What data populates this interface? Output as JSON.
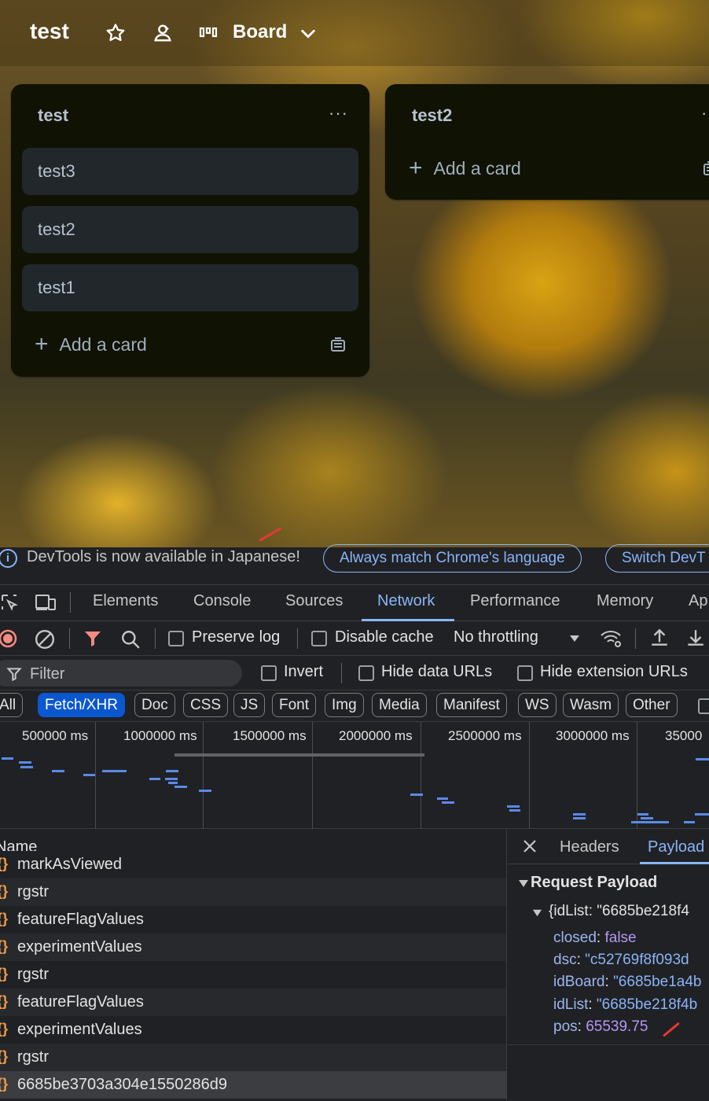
{
  "board_header": {
    "title": "test",
    "view_label": "Board",
    "icons": [
      "star-icon",
      "members-icon",
      "board-view-icon",
      "chevron-down-icon"
    ]
  },
  "lists": [
    {
      "title": "test",
      "menu": "···",
      "cards": [
        "test3",
        "test2",
        "test1"
      ],
      "add_card_label": "Add a card"
    },
    {
      "title": "test2",
      "menu": "··",
      "cards": [],
      "add_card_label": "Add a card"
    }
  ],
  "devtools": {
    "infobar": {
      "message": "DevTools is now available in Japanese!",
      "match_button": "Always match Chrome's language",
      "switch_button": "Switch DevT"
    },
    "tabs": [
      "Elements",
      "Console",
      "Sources",
      "Network",
      "Performance",
      "Memory",
      "Ap"
    ],
    "active_tab": "Network",
    "toolbar": {
      "preserve_log": "Preserve log",
      "disable_cache": "Disable cache",
      "throttling": "No throttling"
    },
    "filter": {
      "placeholder": "Filter",
      "invert": "Invert",
      "hide_data_urls": "Hide data URLs",
      "hide_extension_urls": "Hide extension URLs"
    },
    "type_filters": [
      "All",
      "Fetch/XHR",
      "Doc",
      "CSS",
      "JS",
      "Font",
      "Img",
      "Media",
      "Manifest",
      "WS",
      "Wasm",
      "Other"
    ],
    "active_type": "Fetch/XHR",
    "timeline_labels": [
      "500000 ms",
      "1000000 ms",
      "1500000 ms",
      "2000000 ms",
      "2500000 ms",
      "3000000 ms",
      "35000"
    ],
    "requests_header": "Name",
    "requests": [
      "markAsViewed",
      "rgstr",
      "featureFlagValues",
      "experimentValues",
      "rgstr",
      "featureFlagValues",
      "experimentValues",
      "rgstr",
      "6685be3703a304e1550286d9"
    ],
    "detail": {
      "tabs": [
        "Headers",
        "Payload"
      ],
      "active_tab": "Payload",
      "section_title": "Request Payload",
      "object_summary": "{idList: \"6685be218f4",
      "fields": [
        {
          "key": "closed",
          "value": "false"
        },
        {
          "key": "dsc",
          "value": "\"c52769f8f093d"
        },
        {
          "key": "idBoard",
          "value": "\"6685be1a4b"
        },
        {
          "key": "idList",
          "value": "\"6685be218f4b"
        },
        {
          "key": "pos",
          "value": "65539.75"
        }
      ]
    },
    "colors": {
      "accent": "#8ab4f8",
      "annotation_mark": "#e53935",
      "xhr_icon": "#f29d49"
    }
  }
}
